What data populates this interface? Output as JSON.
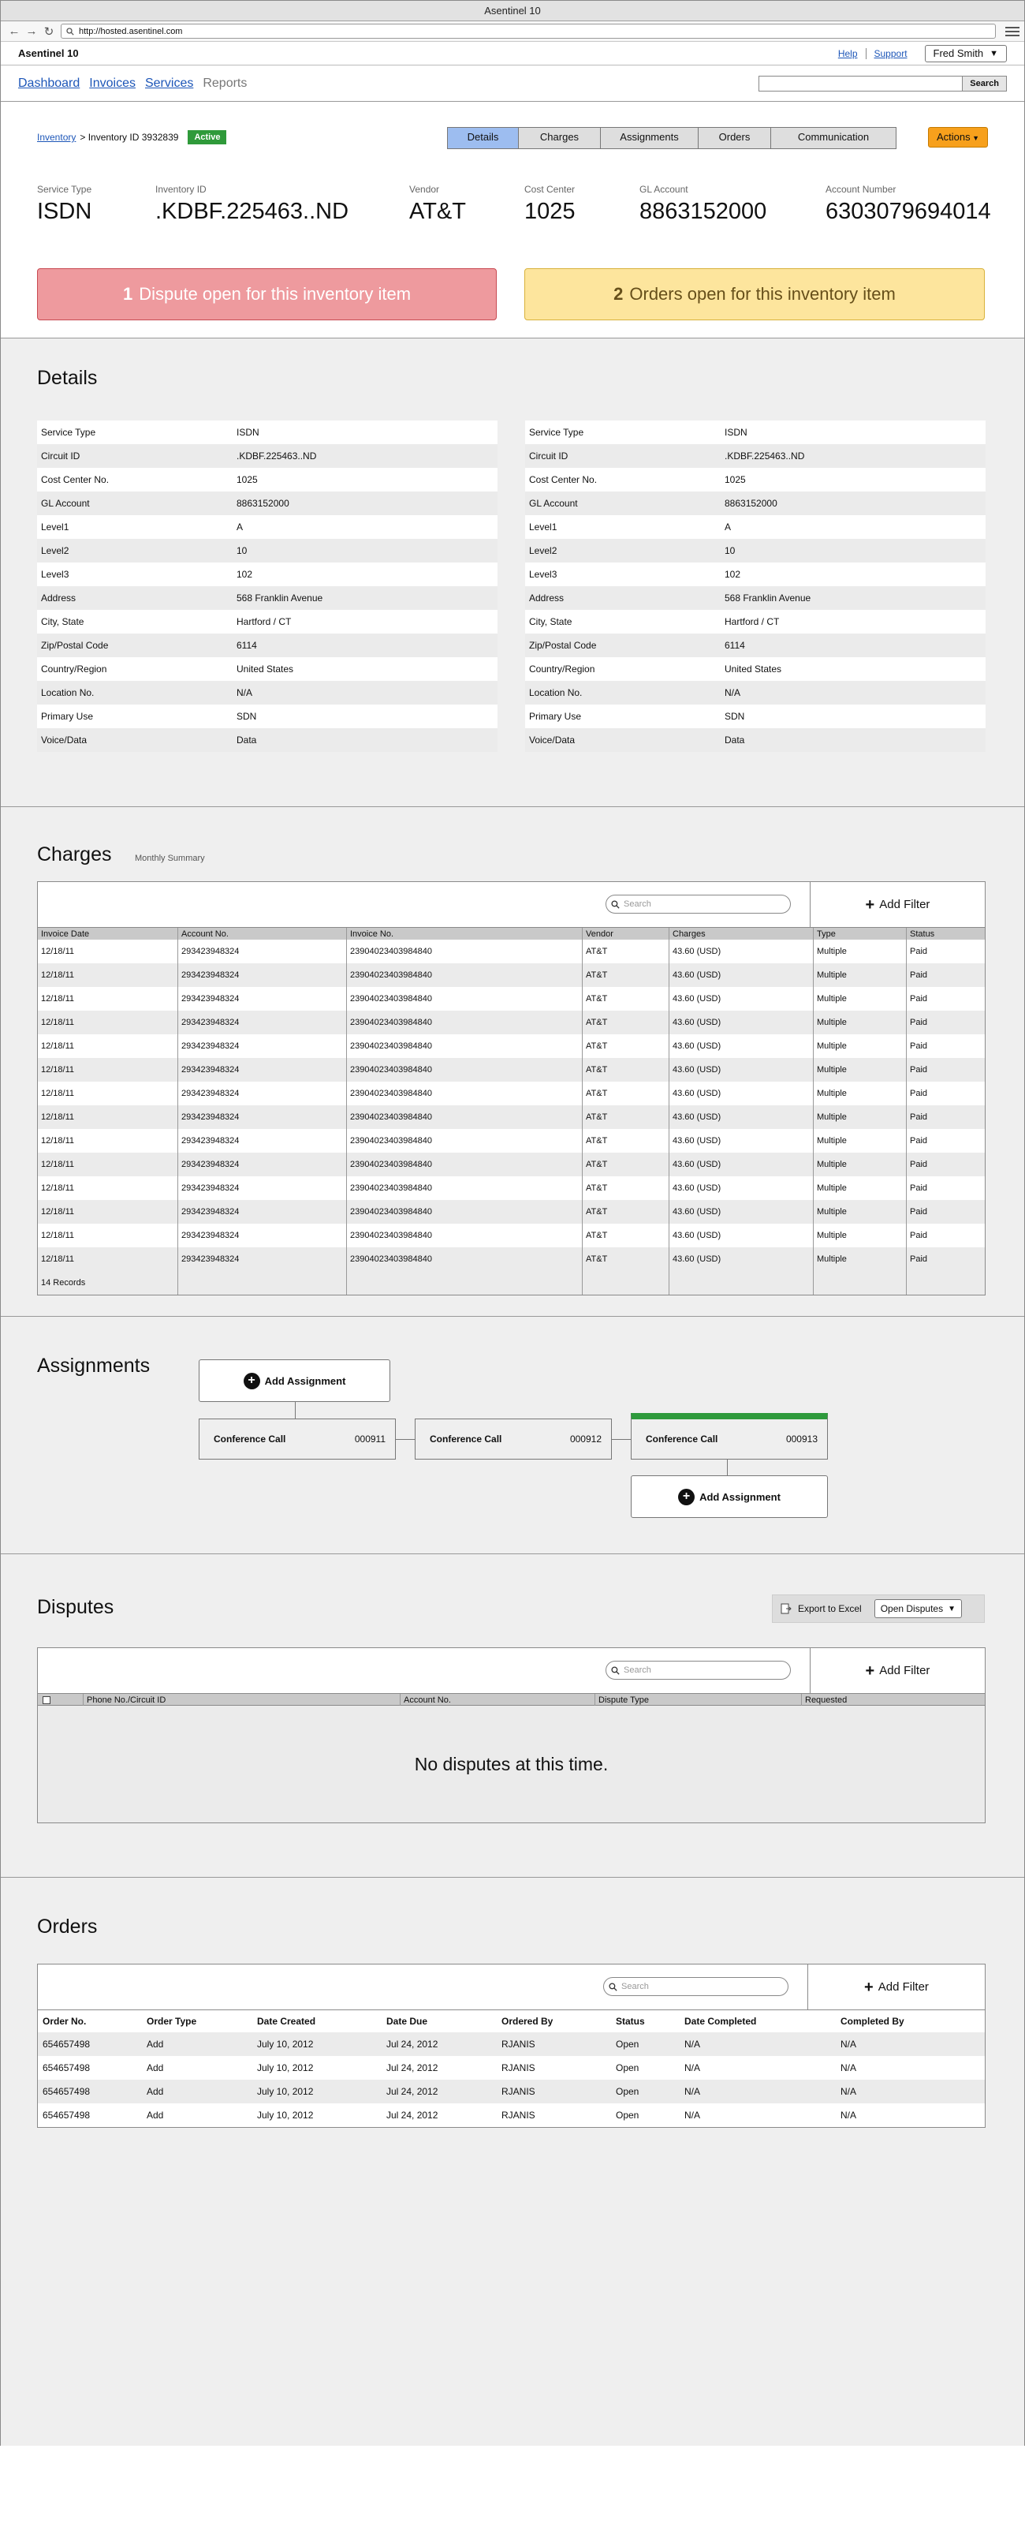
{
  "browser": {
    "window_title": "Asentinel 10",
    "url": "http://hosted.asentinel.com"
  },
  "header": {
    "app_name": "Asentinel 10",
    "help_label": "Help",
    "support_label": "Support",
    "user_name": "Fred Smith",
    "nav": [
      "Dashboard",
      "Invoices",
      "Services",
      "Reports"
    ],
    "search_button": "Search"
  },
  "summary": {
    "breadcrumb_link": "Inventory",
    "breadcrumb_current": "> Inventory ID 3932839",
    "status": "Active",
    "tabs": [
      "Details",
      "Charges",
      "Assignments",
      "Orders",
      "Communication"
    ],
    "actions_label": "Actions",
    "fields": [
      {
        "label": "Service Type",
        "value": "ISDN"
      },
      {
        "label": "Inventory ID",
        "value": ".KDBF.225463..ND"
      },
      {
        "label": "Vendor",
        "value": "AT&T"
      },
      {
        "label": "Cost Center",
        "value": "1025"
      },
      {
        "label": "GL Account",
        "value": "8863152000"
      },
      {
        "label": "Account Number",
        "value": "6303079694014"
      }
    ],
    "dispute_alert": {
      "count": "1",
      "text": "Dispute open for this inventory item"
    },
    "orders_alert": {
      "count": "2",
      "text": "Orders open for this inventory item"
    }
  },
  "details": {
    "title": "Details",
    "rows": [
      {
        "k": "Service Type",
        "v": "ISDN"
      },
      {
        "k": "Circuit ID",
        "v": ".KDBF.225463..ND"
      },
      {
        "k": "Cost Center No.",
        "v": "1025"
      },
      {
        "k": "GL Account",
        "v": "8863152000"
      },
      {
        "k": "Level1",
        "v": "A"
      },
      {
        "k": "Level2",
        "v": "10"
      },
      {
        "k": "Level3",
        "v": "102"
      },
      {
        "k": "Address",
        "v": "568 Franklin Avenue"
      },
      {
        "k": "City, State",
        "v": "Hartford / CT"
      },
      {
        "k": "Zip/Postal Code",
        "v": "6114"
      },
      {
        "k": "Country/Region",
        "v": "United States"
      },
      {
        "k": "Location No.",
        "v": "N/A"
      },
      {
        "k": "Primary Use",
        "v": "SDN"
      },
      {
        "k": "Voice/Data",
        "v": "Data"
      }
    ]
  },
  "charges": {
    "title": "Charges",
    "subtitle": "Monthly Summary",
    "search_placeholder": "Search",
    "add_filter_label": "Add Filter",
    "columns": [
      "Invoice Date",
      "Account No.",
      "Invoice No.",
      "Vendor",
      "Charges",
      "Type",
      "Status"
    ],
    "rows": [
      [
        "12/18/11",
        "293423948324",
        "239040234039848­40",
        "AT&T",
        "43.60 (USD)",
        "Multiple",
        "Paid"
      ],
      [
        "12/18/11",
        "293423948324",
        "23904023403984840",
        "AT&T",
        "43.60 (USD)",
        "Multiple",
        "Paid"
      ],
      [
        "12/18/11",
        "293423948324",
        "23904023403984840",
        "AT&T",
        "43.60 (USD)",
        "Multiple",
        "Paid"
      ],
      [
        "12/18/11",
        "293423948324",
        "23904023403984840",
        "AT&T",
        "43.60 (USD)",
        "Multiple",
        "Paid"
      ],
      [
        "12/18/11",
        "293423948324",
        "23904023403984840",
        "AT&T",
        "43.60 (USD)",
        "Multiple",
        "Paid"
      ],
      [
        "12/18/11",
        "293423948324",
        "23904023403984840",
        "AT&T",
        "43.60 (USD)",
        "Multiple",
        "Paid"
      ],
      [
        "12/18/11",
        "293423948324",
        "23904023403984840",
        "AT&T",
        "43.60 (USD)",
        "Multiple",
        "Paid"
      ],
      [
        "12/18/11",
        "293423948324",
        "23904023403984840",
        "AT&T",
        "43.60 (USD)",
        "Multiple",
        "Paid"
      ],
      [
        "12/18/11",
        "293423948324",
        "23904023403984840",
        "AT&T",
        "43.60 (USD)",
        "Multiple",
        "Paid"
      ],
      [
        "12/18/11",
        "293423948324",
        "23904023403984840",
        "AT&T",
        "43.60 (USD)",
        "Multiple",
        "Paid"
      ],
      [
        "12/18/11",
        "293423948324",
        "23904023403984840",
        "AT&T",
        "43.60 (USD)",
        "Multiple",
        "Paid"
      ],
      [
        "12/18/11",
        "293423948324",
        "23904023403984840",
        "AT&T",
        "43.60 (USD)",
        "Multiple",
        "Paid"
      ],
      [
        "12/18/11",
        "293423948324",
        "23904023403984840",
        "AT&T",
        "43.60 (USD)",
        "Multiple",
        "Paid"
      ],
      [
        "12/18/11",
        "293423948324",
        "23904023403984840",
        "AT&T",
        "43.60 (USD)",
        "Multiple",
        "Paid"
      ]
    ],
    "footer": "14 Records"
  },
  "assignments": {
    "title": "Assignments",
    "add_label": "Add Assignment",
    "nodes": [
      {
        "name": "Conference Call",
        "number": "000911"
      },
      {
        "name": "Conference Call",
        "number": "000912"
      },
      {
        "name": "Conference Call",
        "number": "000913"
      }
    ]
  },
  "disputes": {
    "title": "Disputes",
    "export_label": "Export to Excel",
    "filter_value": "Open Disputes",
    "search_placeholder": "Search",
    "add_filter_label": "Add Filter",
    "columns": [
      "Phone No./Circuit ID",
      "Account No.",
      "Dispute Type",
      "Requested"
    ],
    "empty_message": "No disputes at this time."
  },
  "orders": {
    "title": "Orders",
    "search_placeholder": "Search",
    "add_filter_label": "Add Filter",
    "columns": [
      "Order No.",
      "Order Type",
      "Date Created",
      "Date Due",
      "Ordered By",
      "Status",
      "Date Completed",
      "Completed By"
    ],
    "rows": [
      [
        "654657498",
        "Add",
        "July 10, 2012",
        "Jul 24, 2012",
        "RJANIS",
        "Open",
        "N/A",
        "N/A"
      ],
      [
        "654657498",
        "Add",
        "July 10, 2012",
        "Jul 24, 2012",
        "RJANIS",
        "Open",
        "N/A",
        "N/A"
      ],
      [
        "654657498",
        "Add",
        "July 10, 2012",
        "Jul 24, 2012",
        "RJANIS",
        "Open",
        "N/A",
        "N/A"
      ],
      [
        "654657498",
        "Add",
        "July 10, 2012",
        "Jul 24, 2012",
        "RJANIS",
        "Open",
        "N/A",
        "N/A"
      ]
    ]
  },
  "colors": {
    "link": "#1d56b8",
    "active_status": "#2f9a3a",
    "active_tab": "#9dbdf0",
    "actions_button": "#f7a01c",
    "dispute_alert": "#ee9a9e",
    "orders_alert": "#fde59d",
    "selected_assignment": "#2e9a3c"
  }
}
